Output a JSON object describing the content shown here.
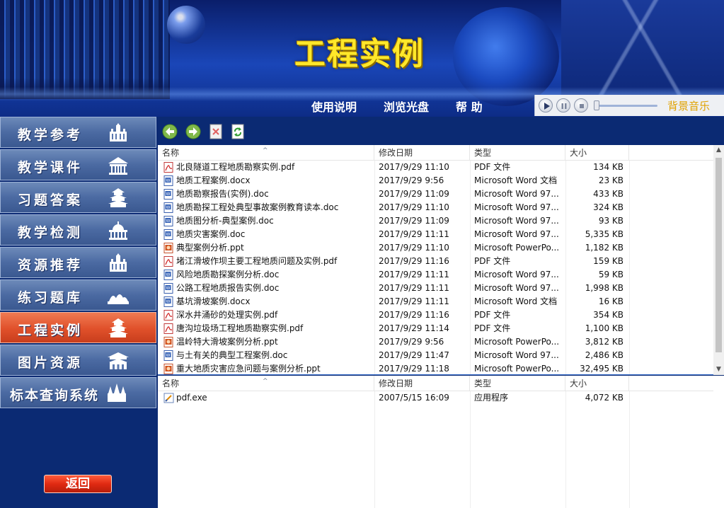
{
  "header": {
    "title": "工程实例",
    "nav": [
      "使用说明",
      "浏览光盘",
      "帮 助"
    ]
  },
  "music_player": {
    "label": "背景音乐",
    "buttons": [
      "play-icon",
      "pause-icon",
      "stop-icon"
    ]
  },
  "sidebar": {
    "items": [
      {
        "label": "教学参考",
        "icon": "hall-icon",
        "active": false
      },
      {
        "label": "教学课件",
        "icon": "temple-icon",
        "active": false
      },
      {
        "label": "习题答案",
        "icon": "pagoda-icon",
        "active": false
      },
      {
        "label": "教学检测",
        "icon": "capitol-icon",
        "active": false
      },
      {
        "label": "资源推荐",
        "icon": "hall-icon",
        "active": false
      },
      {
        "label": "练习题库",
        "icon": "opera-house-icon",
        "active": false
      },
      {
        "label": "工程实例",
        "icon": "pagoda-icon",
        "active": true
      },
      {
        "label": "图片资源",
        "icon": "gate-icon",
        "active": false
      },
      {
        "label": "标本查询系统",
        "icon": "castle-icon",
        "active": false
      }
    ],
    "back_label": "返回"
  },
  "toolbar": {
    "buttons": [
      "back-arrow-icon",
      "forward-arrow-icon",
      "delete-icon",
      "refresh-icon"
    ]
  },
  "columns": [
    "名称",
    "修改日期",
    "类型",
    "大小"
  ],
  "files_top": [
    {
      "icon": "pdf",
      "name": "北良隧道工程地质勘察实例.pdf",
      "date": "2017/9/29 11:10",
      "type": "PDF 文件",
      "size": "134 KB"
    },
    {
      "icon": "word",
      "name": "地质工程案例.docx",
      "date": "2017/9/29 9:56",
      "type": "Microsoft Word 文档",
      "size": "23 KB"
    },
    {
      "icon": "word",
      "name": "地质勘察报告(实例).doc",
      "date": "2017/9/29 11:09",
      "type": "Microsoft Word 97...",
      "size": "433 KB"
    },
    {
      "icon": "word",
      "name": "地质勘探工程处典型事故案例教育读本.doc",
      "date": "2017/9/29 11:10",
      "type": "Microsoft Word 97...",
      "size": "324 KB"
    },
    {
      "icon": "word",
      "name": "地质图分析-典型案例.doc",
      "date": "2017/9/29 11:09",
      "type": "Microsoft Word 97...",
      "size": "93 KB"
    },
    {
      "icon": "word",
      "name": "地质灾害案例.doc",
      "date": "2017/9/29 11:11",
      "type": "Microsoft Word 97...",
      "size": "5,335 KB"
    },
    {
      "icon": "ppt",
      "name": "典型案例分析.ppt",
      "date": "2017/9/29 11:10",
      "type": "Microsoft PowerPo...",
      "size": "1,182 KB"
    },
    {
      "icon": "pdf",
      "name": "堵江滑坡作坝主要工程地质问题及实例.pdf",
      "date": "2017/9/29 11:16",
      "type": "PDF 文件",
      "size": "159 KB"
    },
    {
      "icon": "word",
      "name": "风险地质勘探案例分析.doc",
      "date": "2017/9/29 11:11",
      "type": "Microsoft Word 97...",
      "size": "59 KB"
    },
    {
      "icon": "word",
      "name": "公路工程地质报告实例.doc",
      "date": "2017/9/29 11:11",
      "type": "Microsoft Word 97...",
      "size": "1,998 KB"
    },
    {
      "icon": "word",
      "name": "基坑滑坡案例.docx",
      "date": "2017/9/29 11:11",
      "type": "Microsoft Word 文档",
      "size": "16 KB"
    },
    {
      "icon": "pdf",
      "name": "深水井涌砂的处理实例.pdf",
      "date": "2017/9/29 11:16",
      "type": "PDF 文件",
      "size": "354 KB"
    },
    {
      "icon": "pdf",
      "name": "唐沟垃圾场工程地质勘察实例.pdf",
      "date": "2017/9/29 11:14",
      "type": "PDF 文件",
      "size": "1,100 KB"
    },
    {
      "icon": "ppt",
      "name": "温岭特大滑坡案例分析.ppt",
      "date": "2017/9/29 9:56",
      "type": "Microsoft PowerPo...",
      "size": "3,812 KB"
    },
    {
      "icon": "word",
      "name": "与土有关的典型工程案例.doc",
      "date": "2017/9/29 11:47",
      "type": "Microsoft Word 97...",
      "size": "2,486 KB"
    },
    {
      "icon": "ppt",
      "name": "重大地质灾害应急问题与案例分析.ppt",
      "date": "2017/9/29 11:18",
      "type": "Microsoft PowerPo...",
      "size": "32,495 KB"
    }
  ],
  "files_bottom": [
    {
      "icon": "exe",
      "name": "pdf.exe",
      "date": "2007/5/15 16:09",
      "type": "应用程序",
      "size": "4,072 KB"
    }
  ],
  "colors": {
    "sidebar_bg": "#0b2a73",
    "active_item": "#e0502a",
    "title_yellow": "#ffe82a",
    "music_label": "#e0a200"
  }
}
